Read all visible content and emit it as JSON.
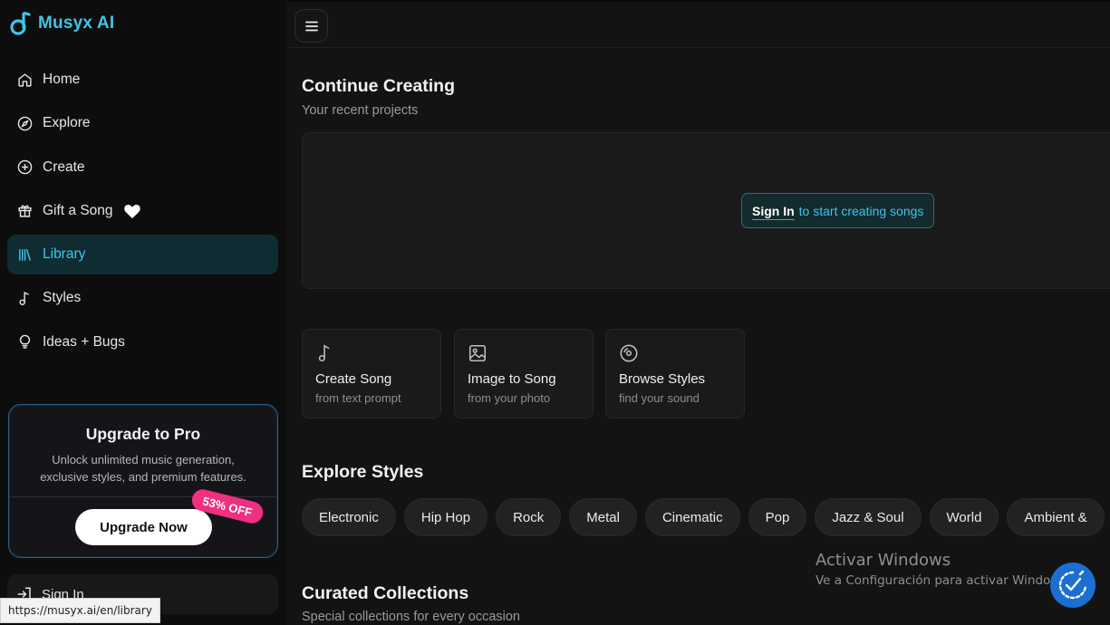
{
  "brand": {
    "name": "Musyx AI"
  },
  "sidebar": {
    "items": [
      {
        "label": "Home",
        "icon": "home-icon"
      },
      {
        "label": "Explore",
        "icon": "compass-icon"
      },
      {
        "label": "Create",
        "icon": "plus-circle-icon"
      },
      {
        "label": "Gift a Song",
        "icon": "gift-icon"
      },
      {
        "label": "Library",
        "icon": "library-icon",
        "active": true
      },
      {
        "label": "Styles",
        "icon": "music-note-icon"
      },
      {
        "label": "Ideas + Bugs",
        "icon": "lightbulb-icon"
      }
    ],
    "upgrade": {
      "title": "Upgrade to Pro",
      "description": "Unlock unlimited music generation, exclusive styles, and premium features.",
      "button": "Upgrade Now",
      "badge": "53% OFF"
    },
    "sign_in": "Sign In"
  },
  "status_bar": {
    "url": "https://musyx.ai/en/library"
  },
  "main": {
    "continue": {
      "title": "Continue Creating",
      "subtitle": "Your recent projects",
      "sign_in_strong": "Sign In",
      "sign_in_rest": "to start creating songs"
    },
    "actions": [
      {
        "title": "Create Song",
        "subtitle": "from text prompt",
        "icon": "music-note-icon"
      },
      {
        "title": "Image to Song",
        "subtitle": "from your photo",
        "icon": "image-icon"
      },
      {
        "title": "Browse Styles",
        "subtitle": "find your sound",
        "icon": "disc-icon"
      }
    ],
    "explore": {
      "title": "Explore Styles",
      "chips": [
        "Electronic",
        "Hip Hop",
        "Rock",
        "Metal",
        "Cinematic",
        "Pop",
        "Jazz & Soul",
        "World",
        "Ambient &"
      ]
    },
    "curated": {
      "title": "Curated Collections",
      "subtitle": "Special collections for every occasion"
    }
  },
  "windows_overlay": {
    "line1": "Activar Windows",
    "line2": "Ve a Configuración para activar Windows."
  },
  "colors": {
    "accent": "#3fc6e8",
    "active_bg": "#0f2c33",
    "badge": "#ef2f7f",
    "fab": "#1c6fd1"
  }
}
